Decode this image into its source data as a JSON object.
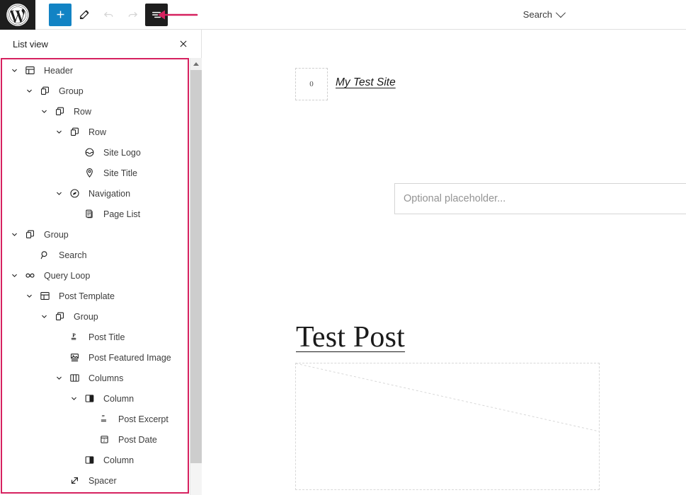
{
  "topbar": {
    "logo_icon": "wordpress-logo-icon",
    "buttons": [
      {
        "name": "add-block-button",
        "icon": "plus-icon",
        "label": "Add block",
        "state": "primary"
      },
      {
        "name": "edit-tool-button",
        "icon": "pencil-icon",
        "label": "Tools",
        "state": "default"
      },
      {
        "name": "undo-button",
        "icon": "undo-icon",
        "label": "Undo",
        "state": "disabled"
      },
      {
        "name": "redo-button",
        "icon": "redo-icon",
        "label": "Redo",
        "state": "disabled"
      },
      {
        "name": "list-view-button",
        "icon": "list-view-icon",
        "label": "List view",
        "state": "active"
      }
    ],
    "annotation_arrow": {
      "icon": "left-arrow-annotation-icon",
      "color": "#d6215f"
    },
    "right_menu": {
      "label": "Search",
      "icon": "chevron-down-icon"
    }
  },
  "list_view": {
    "title": "List view",
    "close_icon": "close-icon",
    "highlight_color": "#d6215f",
    "scrollbar": {
      "up_icon": "scroll-up-arrow-icon"
    },
    "items": [
      {
        "label": "Header",
        "icon": "header-block-icon",
        "depth": 0,
        "expanded": true
      },
      {
        "label": "Group",
        "icon": "group-block-icon",
        "depth": 1,
        "expanded": true
      },
      {
        "label": "Row",
        "icon": "group-block-icon",
        "depth": 2,
        "expanded": true
      },
      {
        "label": "Row",
        "icon": "group-block-icon",
        "depth": 3,
        "expanded": true
      },
      {
        "label": "Site Logo",
        "icon": "site-logo-block-icon",
        "depth": 4,
        "expanded": null
      },
      {
        "label": "Site Title",
        "icon": "site-title-block-icon",
        "depth": 4,
        "expanded": null
      },
      {
        "label": "Navigation",
        "icon": "navigation-block-icon",
        "depth": 3,
        "expanded": true
      },
      {
        "label": "Page List",
        "icon": "page-list-block-icon",
        "depth": 4,
        "expanded": null
      },
      {
        "label": "Group",
        "icon": "group-block-icon",
        "depth": 0,
        "expanded": true
      },
      {
        "label": "Search",
        "icon": "search-block-icon",
        "depth": 1,
        "expanded": null
      },
      {
        "label": "Query Loop",
        "icon": "query-loop-block-icon",
        "depth": 0,
        "expanded": true
      },
      {
        "label": "Post Template",
        "icon": "post-template-block-icon",
        "depth": 1,
        "expanded": true
      },
      {
        "label": "Group",
        "icon": "group-block-icon",
        "depth": 2,
        "expanded": true
      },
      {
        "label": "Post Title",
        "icon": "post-title-block-icon",
        "depth": 3,
        "expanded": null
      },
      {
        "label": "Post Featured Image",
        "icon": "featured-image-block-icon",
        "depth": 3,
        "expanded": null
      },
      {
        "label": "Columns",
        "icon": "columns-block-icon",
        "depth": 3,
        "expanded": true
      },
      {
        "label": "Column",
        "icon": "column-block-icon",
        "depth": 4,
        "expanded": true
      },
      {
        "label": "Post Excerpt",
        "icon": "post-excerpt-block-icon",
        "depth": 5,
        "expanded": null
      },
      {
        "label": "Post Date",
        "icon": "post-date-block-icon",
        "depth": 5,
        "expanded": null
      },
      {
        "label": "Column",
        "icon": "column-block-icon",
        "depth": 4,
        "expanded": null
      },
      {
        "label": "Spacer",
        "icon": "spacer-block-icon",
        "depth": 3,
        "expanded": null
      }
    ]
  },
  "canvas": {
    "site_logo_placeholder": "0",
    "site_title": "My Test Site",
    "search_placeholder": "Optional placeholder...",
    "post_title": "Test Post",
    "featured_image_icon": "image-placeholder-icon"
  }
}
